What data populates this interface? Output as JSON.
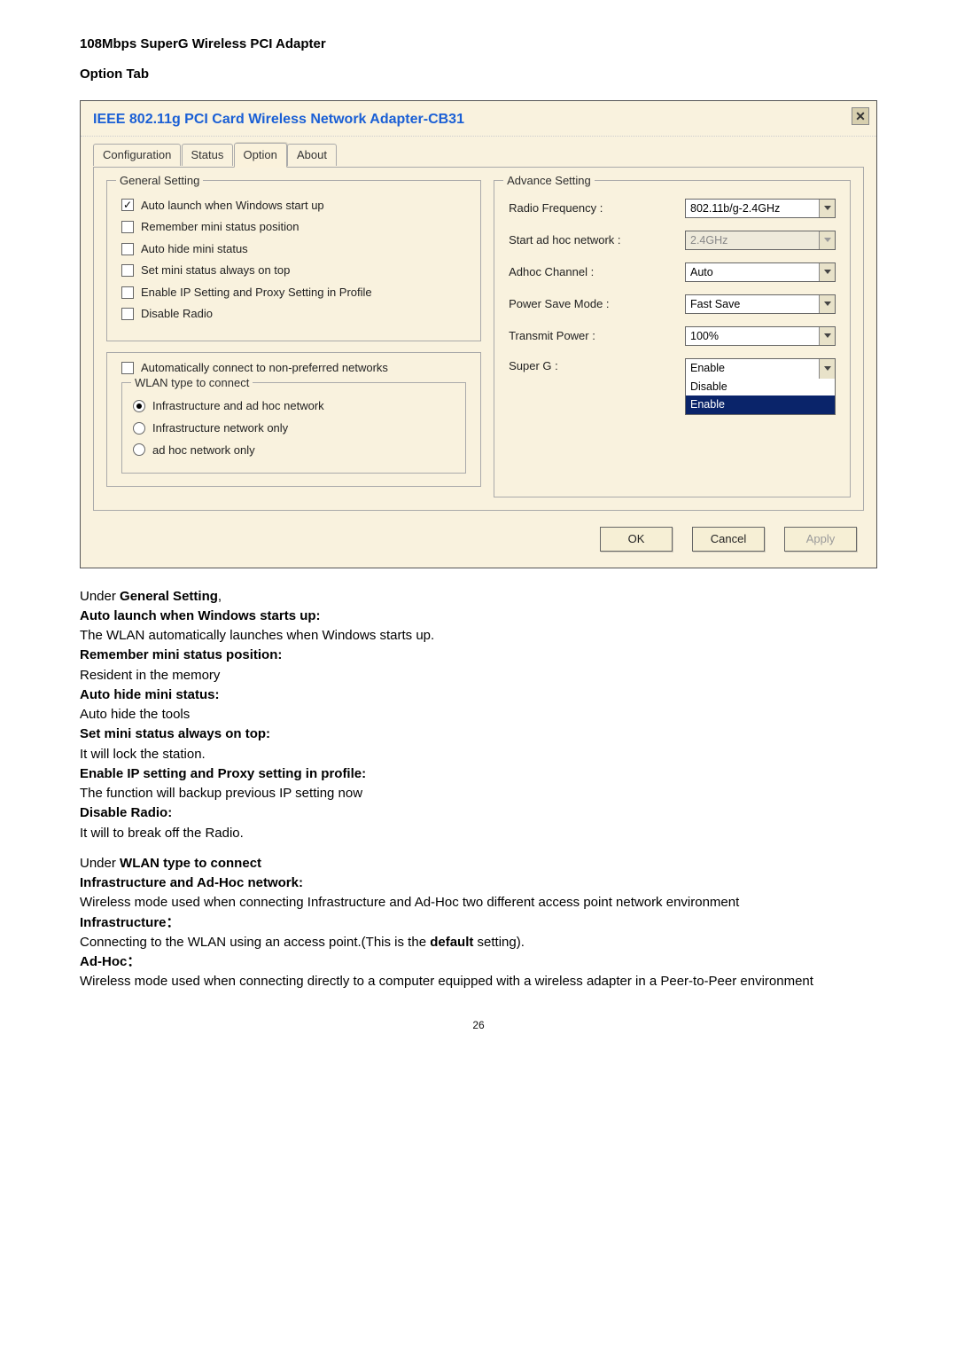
{
  "doc": {
    "product_title": "108Mbps SuperG Wireless PCI Adapter",
    "option_tab_label": "Option Tab",
    "under_general_label": "Under General Setting,",
    "items": {
      "auto_launch_h": "Auto launch when Windows starts up:",
      "auto_launch_t": "The WLAN automatically launches when Windows starts up.",
      "remember_h": "Remember mini status position:",
      "remember_t": "Resident in the memory",
      "autohide_h": "Auto hide mini status:",
      "autohide_t": "Auto hide the tools",
      "setmini_h": "Set mini status always on top:",
      "setmini_t": "It will lock the station.",
      "enableip_h": "Enable IP setting and Proxy setting in profile:",
      "enableip_t": "The function will backup previous IP setting now",
      "disableradio_h": "Disable Radio:",
      "disableradio_t": "It will to break off the Radio."
    },
    "under_wlan_label": "Under WLAN type to connect",
    "wlan": {
      "infra_adhoc_h": "Infrastructure and Ad-Hoc network:",
      "infra_adhoc_t": "Wireless mode used when connecting Infrastructure and Ad-Hoc two different access point network environment",
      "infra_h": "Infrastructure：",
      "infra_t_pre": "Connecting to the WLAN using an access point.(This is the ",
      "infra_t_mid": "default",
      "infra_t_post": " setting).",
      "adhoc_h": "Ad-Hoc：",
      "adhoc_t": "Wireless mode used when connecting directly to a computer equipped with a wireless adapter in a Peer-to-Peer environment"
    },
    "page_num": "26"
  },
  "dialog": {
    "title": "IEEE 802.11g  PCI Card Wireless Network Adapter-CB31",
    "tabs": {
      "configuration": "Configuration",
      "status": "Status",
      "option": "Option",
      "about": "About"
    },
    "general_setting": {
      "legend": "General Setting",
      "auto_launch": "Auto launch when Windows start up",
      "remember": "Remember mini status position",
      "autohide": "Auto hide mini status",
      "ontop": "Set mini status always on top",
      "enableip": "Enable IP Setting and Proxy Setting in Profile",
      "disable_radio": "Disable Radio"
    },
    "auto_connect": "Automatically connect to non-preferred networks",
    "wlan_type": {
      "legend": "WLAN type to connect",
      "opt1": "Infrastructure and ad hoc network",
      "opt2": "Infrastructure network only",
      "opt3": "ad hoc network only"
    },
    "advance": {
      "legend": "Advance Setting",
      "radio_freq_l": "Radio Frequency :",
      "radio_freq_v": "802.11b/g-2.4GHz",
      "start_adhoc_l": "Start ad hoc network :",
      "start_adhoc_v": "2.4GHz",
      "adhoc_ch_l": "Adhoc Channel :",
      "adhoc_ch_v": "Auto",
      "psm_l": "Power Save Mode :",
      "psm_v": "Fast Save",
      "txpwr_l": "Transmit Power :",
      "txpwr_v": "100%",
      "superg_l": "Super G :",
      "superg_v": "Enable",
      "superg_opts": {
        "disable": "Disable",
        "enable": "Enable"
      }
    },
    "buttons": {
      "ok": "OK",
      "cancel": "Cancel",
      "apply": "Apply"
    }
  }
}
